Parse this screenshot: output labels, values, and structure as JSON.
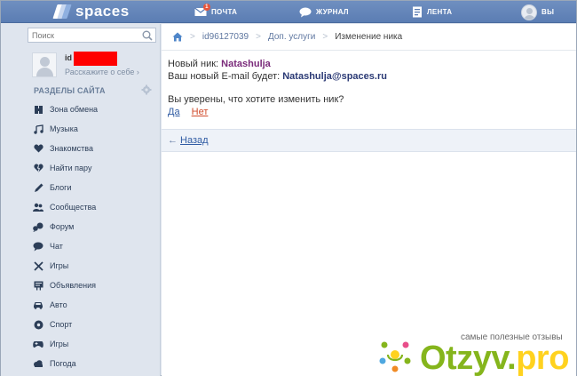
{
  "header": {
    "logo_text": "spaces",
    "nav": [
      {
        "label": "ПОЧТА",
        "icon": "mail-icon",
        "badge": "1"
      },
      {
        "label": "ЖУРНАЛ",
        "icon": "chat-bubble-icon"
      },
      {
        "label": "ЛЕНТА",
        "icon": "feed-icon"
      },
      {
        "label": "ВЫ",
        "icon": "avatar-icon"
      }
    ]
  },
  "sidebar": {
    "search_placeholder": "Поиск",
    "user": {
      "id_prefix": "id",
      "tagline": "Расскажите о себе ›"
    },
    "section_title": "РАЗДЕЛЫ САЙТА",
    "items": [
      {
        "label": "Зона обмена",
        "icon": "exchange-icon"
      },
      {
        "label": "Музыка",
        "icon": "music-note-icon"
      },
      {
        "label": "Знакомства",
        "icon": "heart-icon"
      },
      {
        "label": "Найти пару",
        "icon": "broken-heart-icon"
      },
      {
        "label": "Блоги",
        "icon": "pen-icon"
      },
      {
        "label": "Сообщества",
        "icon": "people-icon"
      },
      {
        "label": "Форум",
        "icon": "forum-icon"
      },
      {
        "label": "Чат",
        "icon": "chat-icon"
      },
      {
        "label": "Игры",
        "icon": "cross-swords-icon"
      },
      {
        "label": "Объявления",
        "icon": "board-icon"
      },
      {
        "label": "Авто",
        "icon": "car-icon"
      },
      {
        "label": "Спорт",
        "icon": "ball-icon"
      },
      {
        "label": "Игры",
        "icon": "gamepad-icon"
      },
      {
        "label": "Погода",
        "icon": "cloud-icon"
      }
    ]
  },
  "breadcrumbs": {
    "home_icon": "home-icon",
    "items": [
      "id96127039",
      "Доп. услуги"
    ],
    "current": "Изменение ника"
  },
  "content": {
    "nick_label": "Новый ник:",
    "nick_value": "Natashulja",
    "email_label": "Ваш новый E-mail будет:",
    "email_value": "Natashulja@spaces.ru",
    "question": "Вы уверены, что хотите изменить ник?",
    "yes": "Да",
    "no": "Нет",
    "back_arrow": "←",
    "back": "Назад"
  },
  "watermark": {
    "tagline": "самые полезные отзывы",
    "word": "Otzyv.",
    "word_accent": "pro"
  },
  "colors": {
    "topbar": "#5b7db3",
    "sidebar_bg": "#dfe5ee",
    "link": "#2f5ba3",
    "nick": "#7a2a7a",
    "no_link": "#d04a2a",
    "redaction": "#ff0000"
  }
}
